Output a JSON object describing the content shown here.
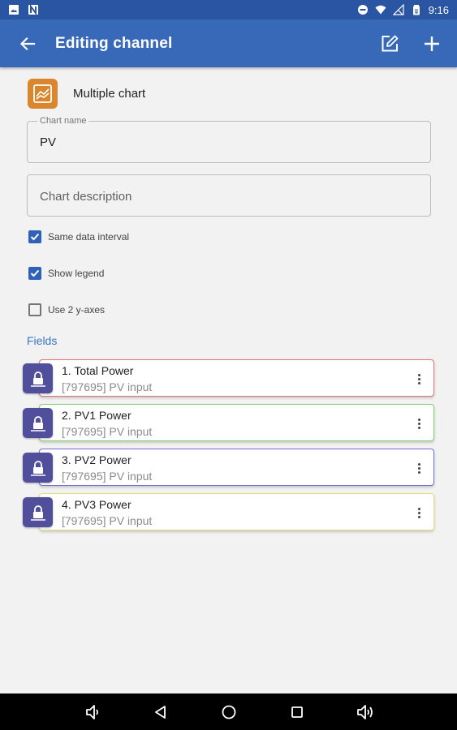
{
  "status_bar": {
    "time": "9:16",
    "icons": [
      "image-icon",
      "n-logo-icon",
      "minus-circle-icon",
      "wifi-icon",
      "no-signal-icon",
      "battery-icon"
    ]
  },
  "app_bar": {
    "title": "Editing channel",
    "background": "#3868b8",
    "actions": [
      "edit-icon",
      "add-icon"
    ]
  },
  "chart_type": {
    "label": "Multiple chart",
    "icon": "line-chart-icon",
    "icon_color": "#d9862e"
  },
  "form": {
    "chart_name": {
      "label": "Chart name",
      "value": "PV"
    },
    "chart_description": {
      "placeholder": "Chart description",
      "value": ""
    }
  },
  "options": [
    {
      "label": "Same data interval",
      "checked": true
    },
    {
      "label": "Show legend",
      "checked": true
    },
    {
      "label": "Use 2 y-axes",
      "checked": false
    }
  ],
  "fields_section": {
    "title": "Fields"
  },
  "fields": [
    {
      "title": "1. Total Power",
      "subtitle": "[797695] PV input",
      "color": "#e57373"
    },
    {
      "title": "2. PV1 Power",
      "subtitle": "[797695] PV input",
      "color": "#7cd36c"
    },
    {
      "title": "3. PV2 Power",
      "subtitle": "[797695] PV input",
      "color": "#6f6fd6"
    },
    {
      "title": "4. PV3 Power",
      "subtitle": "[797695] PV input",
      "color": "#e5df7a"
    }
  ],
  "nav_bar": {
    "buttons": [
      "volume-down-icon",
      "back-triangle-icon",
      "home-circle-icon",
      "recents-square-icon",
      "volume-up-icon"
    ]
  }
}
